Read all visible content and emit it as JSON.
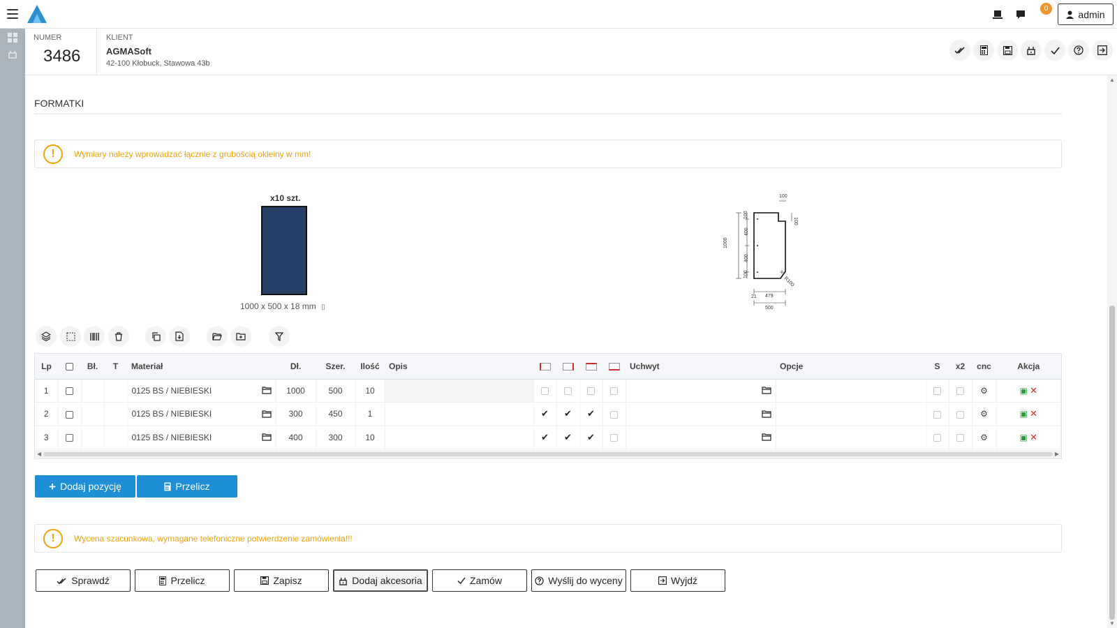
{
  "user": {
    "name": "admin",
    "notifications": "0"
  },
  "order": {
    "number_label": "NUMER",
    "number": "3486",
    "client_label": "KLIENT",
    "client_name": "AGMASoft",
    "client_address": "42-100 Kłobuck, Stawowa 43b"
  },
  "section": {
    "title": "FORMATKI"
  },
  "alerts": {
    "dimensions": "Wymiary należy wprowadzać łącznie z grubością okleiny w mm!",
    "estimate": "Wycena szacunkowa, wymagane telefoniczne potwierdzenie zamówienia!!!"
  },
  "preview": {
    "quantity": "x10 szt.",
    "dimensions": "1000 x 500 x 18 mm",
    "panel_color": "#263f66",
    "drawing": {
      "top_notch": "100",
      "right_notch": "100",
      "height_total": "1000",
      "segments": [
        "100",
        "400",
        "400",
        "100"
      ],
      "radius": "R100",
      "offset": "21",
      "inner_width": "479",
      "width_total": "500"
    }
  },
  "table": {
    "headers": {
      "lp": "Lp",
      "bl": "Bł.",
      "t": "T",
      "material": "Materiał",
      "dl": "Dł.",
      "szer": "Szer.",
      "ilosc": "Ilość",
      "opis": "Opis",
      "uchwyt": "Uchwyt",
      "opcje": "Opcje",
      "s": "S",
      "x2": "x2",
      "cnc": "cnc",
      "akcja": "Akcja"
    },
    "rows": [
      {
        "lp": "1",
        "material": "0125 BS / NIEBIESKI",
        "dl": "1000",
        "szer": "500",
        "ilosc": "10",
        "opis": "",
        "edges": [
          false,
          false,
          false,
          false
        ]
      },
      {
        "lp": "2",
        "material": "0125 BS / NIEBIESKI",
        "dl": "300",
        "szer": "450",
        "ilosc": "1",
        "opis": "",
        "edges": [
          true,
          true,
          true,
          false
        ]
      },
      {
        "lp": "3",
        "material": "0125 BS / NIEBIESKI",
        "dl": "400",
        "szer": "300",
        "ilosc": "10",
        "opis": "",
        "edges": [
          true,
          true,
          true,
          false
        ]
      }
    ]
  },
  "actions": {
    "add_position": "Dodaj pozycję",
    "recalc": "Przelicz"
  },
  "bottom": {
    "check": "Sprawdź",
    "recalc": "Przelicz",
    "save": "Zapisz",
    "accessories": "Dodaj akcesoria",
    "order": "Zamów",
    "send_quote": "Wyślij do wyceny",
    "exit": "Wyjdź"
  },
  "colors": {
    "accent": "#1e8fd6",
    "warning": "#f0a30a",
    "badge": "#f0932b",
    "rail": "#a9b3bc"
  }
}
